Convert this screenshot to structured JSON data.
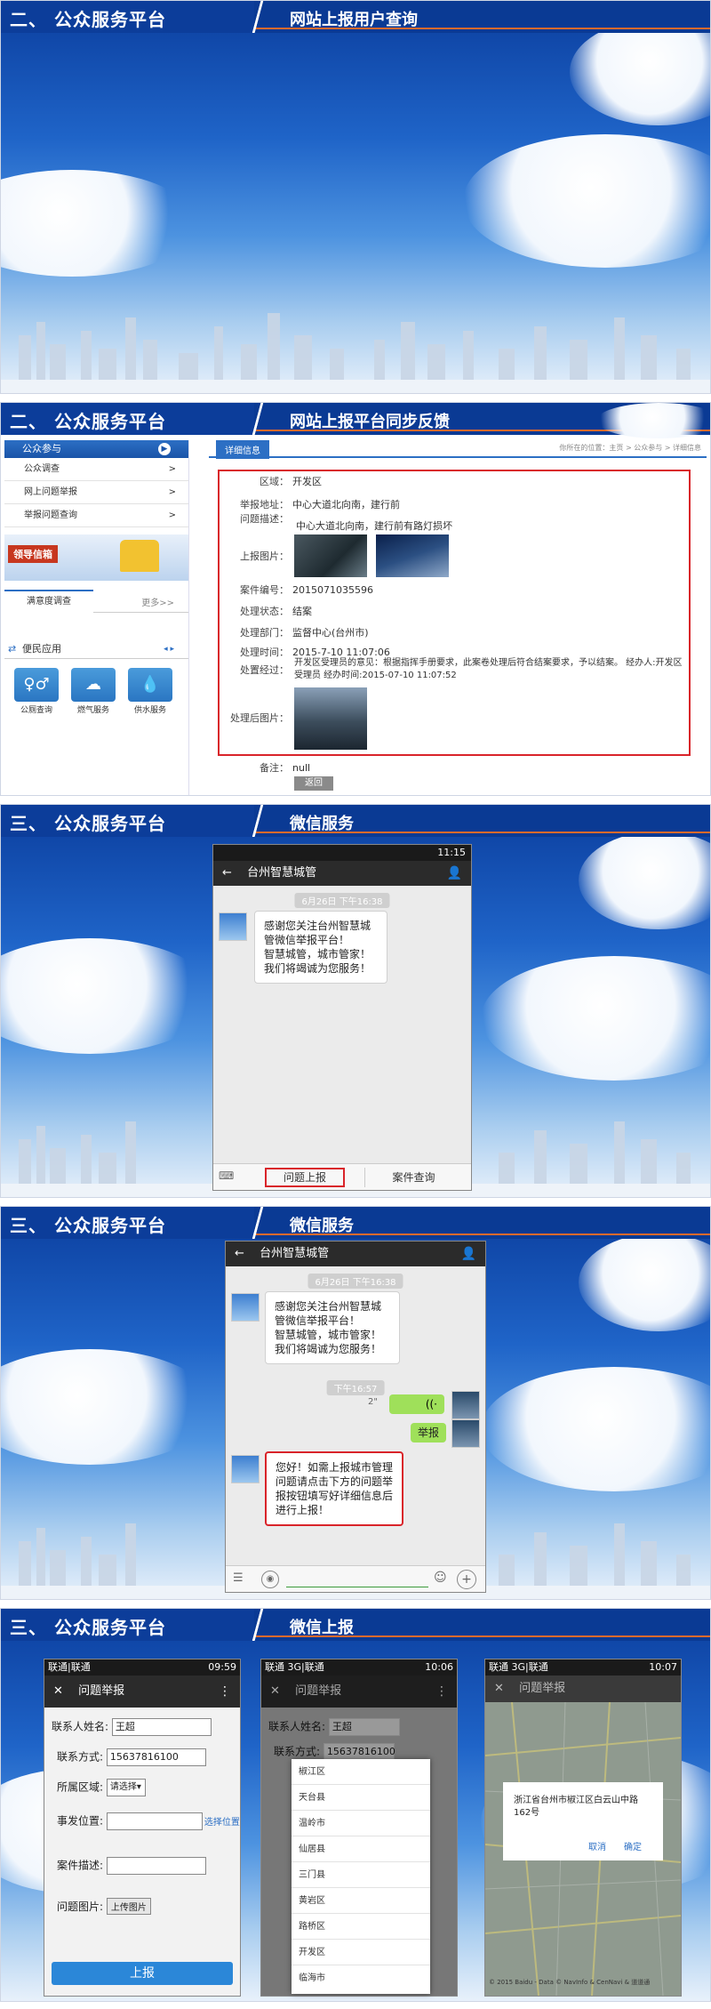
{
  "slides": [
    {
      "left": "二、 公众服务平台",
      "right": "网站上报用户查询"
    },
    {
      "left": "二、 公众服务平台",
      "right": "网站上报平台同步反馈"
    },
    {
      "left": "三、 公众服务平台",
      "right": "微信服务"
    },
    {
      "left": "三、 公众服务平台",
      "right": "微信服务"
    },
    {
      "left": "三、 公众服务平台",
      "right": "微信上报"
    }
  ],
  "portal": {
    "sidebar_title": "公众参与",
    "menu": [
      "公众调查",
      "网上问题举报",
      "举报问题查询"
    ],
    "banner": "领导信箱",
    "survey_tab": "满意度调查",
    "more": "更多>>",
    "apps_title": "便民应用",
    "apps": [
      "公厕查询",
      "燃气服务",
      "供水服务"
    ],
    "detail_tab": "详细信息",
    "breadcrumb": "你所在的位置：主页 > 公众参与 > 详细信息",
    "fields": {
      "area_k": "区域：",
      "area_v": "开发区",
      "addr_k": "举报地址：",
      "addr_v": "中心大道北向南，建行前",
      "desc_k": "问题描述：",
      "desc_v": "中心大道北向南，建行前有路灯损坏",
      "img_k": "上报图片：",
      "case_k": "案件编号：",
      "case_v": "2015071035596",
      "state_k": "处理状态：",
      "state_v": "结案",
      "dept_k": "处理部门：",
      "dept_v": "监督中心(台州市)",
      "time_k": "处理时间：",
      "time_v": "2015-7-10 11:07:06",
      "proc_k": "处置经过：",
      "proc_v": "开发区受理员的意见：根据指挥手册要求，此案卷处理后符合结案要求，予以结案。 经办人:开发区受理员 经办时间:2015-07-10 11:07:52",
      "after_k": "处理后图片：",
      "note_k": "备注：",
      "note_v": "null",
      "back": "返回"
    }
  },
  "wechat1": {
    "status_time": "11:15",
    "title": "台州智慧城管",
    "date_pill": "6月26日 下午16:38",
    "welcome": "感谢您关注台州智慧城管微信举报平台！\n智慧城管，城市管家！我们将竭诚为您服务！",
    "menu_report": "问题上报",
    "menu_query": "案件查询"
  },
  "wechat2": {
    "title": "台州智慧城管",
    "date_pill": "6月26日 下午16:38",
    "welcome": "感谢您关注台州智慧城管微信举报平台！\n智慧城管，城市管家！我们将竭诚为您服务！",
    "time_pill": "下午16:57",
    "voice_len": "2\"",
    "user_msg": "举报",
    "reply": "您好！如需上报城市管理问题请点击下方的问题举报按钮填写好详细信息后进行上报！"
  },
  "form": {
    "status_carrier": "联通|联通",
    "status_time": "09:59",
    "title": "问题举报",
    "name_k": "联系人姓名:",
    "name_v": "王超",
    "phone_k": "联系方式:",
    "phone_v": "15637816100",
    "area_k": "所属区域:",
    "area_v": "请选择",
    "loc_k": "事发位置:",
    "loc_btn": "选择位置",
    "desc_k": "案件描述:",
    "img_k": "问题图片:",
    "img_btn": "上传图片",
    "submit": "上报"
  },
  "picker": {
    "status_carrier": "联通 3G|联通",
    "status_time": "10:06",
    "title": "问题举报",
    "name_k": "联系人姓名:",
    "name_v": "王超",
    "phone_k": "联系方式:",
    "phone_v": "15637816100",
    "options": [
      "椒江区",
      "天台县",
      "温岭市",
      "仙居县",
      "三门县",
      "黄岩区",
      "路桥区",
      "开发区",
      "临海市"
    ]
  },
  "mapscreen": {
    "status_carrier": "联通 3G|联通",
    "status_time": "10:07",
    "title": "问题举报",
    "address": "浙江省台州市椒江区白云山中路162号",
    "cancel": "取消",
    "ok": "确定",
    "copyright": "© 2015 Baidu - Data © NavInfo & CenNavi & 道道通"
  }
}
